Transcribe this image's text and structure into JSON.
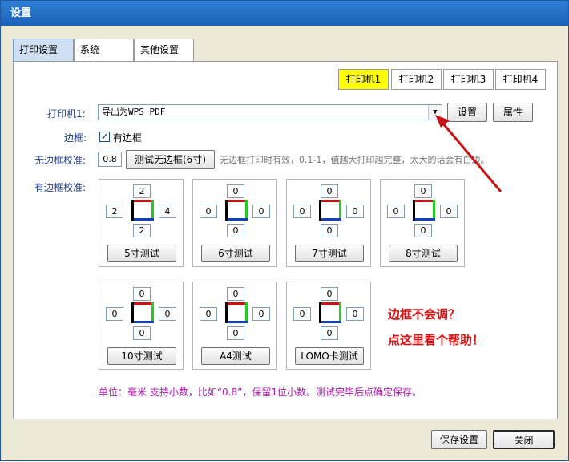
{
  "window": {
    "title": "设置"
  },
  "main_tabs": [
    {
      "label": "打印设置",
      "active": true
    },
    {
      "label": "系统",
      "active": false
    },
    {
      "label": "其他设置",
      "active": false
    }
  ],
  "printer_tabs": [
    {
      "label": "打印机1",
      "active": true
    },
    {
      "label": "打印机2",
      "active": false
    },
    {
      "label": "打印机3",
      "active": false
    },
    {
      "label": "打印机4",
      "active": false
    }
  ],
  "printer": {
    "label": "打印机1:",
    "selected": "导出为WPS PDF",
    "settings_button": "设置",
    "properties_button": "属性"
  },
  "border": {
    "label": "边框:",
    "checkbox_label": "有边框",
    "checked": true
  },
  "borderless_calibration": {
    "label": "无边框校准:",
    "value": "0.8",
    "test_button": "测试无边框(6寸)",
    "hint": "无边框打印时有效，0.1-1，值越大打印越完整，太大的话会有白边。"
  },
  "bordered_calibration": {
    "label": "有边框校准:",
    "groups": [
      {
        "top": "2",
        "left": "2",
        "right": "4",
        "bottom": "2",
        "button": "5寸测试"
      },
      {
        "top": "0",
        "left": "0",
        "right": "0",
        "bottom": "0",
        "button": "6寸测试"
      },
      {
        "top": "0",
        "left": "0",
        "right": "0",
        "bottom": "0",
        "button": "7寸测试"
      },
      {
        "top": "0",
        "left": "0",
        "right": "0",
        "bottom": "0",
        "button": "8寸测试"
      },
      {
        "top": "0",
        "left": "0",
        "right": "0",
        "bottom": "0",
        "button": "10寸测试"
      },
      {
        "top": "0",
        "left": "0",
        "right": "0",
        "bottom": "0",
        "button": "A4测试"
      },
      {
        "top": "0",
        "left": "0",
        "right": "0",
        "bottom": "0",
        "button": "LOMO卡测试"
      }
    ]
  },
  "help": {
    "line1": "边框不会调？",
    "line2": "点这里看个帮助！"
  },
  "note": "单位：毫米   支持小数，比如“0.8”，保留1位小数。测试完毕后点确定保存。",
  "footer": {
    "save_button": "保存设置",
    "close_button": "关闭"
  },
  "colors": {
    "active_printer_tab": "#ffff00",
    "annotation_arrow": "#c81414",
    "help_text": "#e01010",
    "note_text": "#b016b0",
    "frame_top": "#d01010",
    "frame_right": "#22cc22",
    "frame_bottom": "#1040c0",
    "frame_left": "#000000"
  }
}
